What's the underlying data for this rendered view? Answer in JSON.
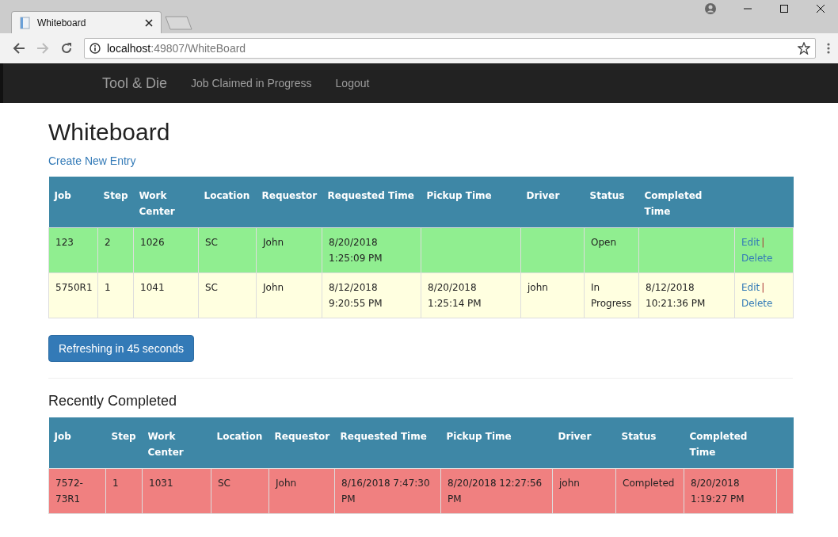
{
  "browser": {
    "tab_title": "Whiteboard",
    "address_host": "localhost",
    "address_rest": ":49807/WhiteBoard"
  },
  "navbar": {
    "brand": "Tool & Die",
    "links": [
      "Job Claimed in Progress",
      "Logout"
    ]
  },
  "page_title": "Whiteboard",
  "create_link": "Create New Entry",
  "jobs_table": {
    "columns": [
      "Job",
      "Step",
      "Work Center",
      "Location",
      "Requestor",
      "Requested Time",
      "Pickup Time",
      "Driver",
      "Status",
      "Completed Time",
      ""
    ],
    "rows": [
      {
        "color": "#90ee90",
        "cells": [
          "123",
          "2",
          "1026",
          "SC",
          "John",
          "8/20/2018 1:25:09 PM",
          "",
          "",
          "Open",
          ""
        ],
        "actions": {
          "edit": "Edit",
          "separator": "|",
          "delete": "Delete"
        }
      },
      {
        "color": "#ffffe0",
        "cells": [
          "5750R1",
          "1",
          "1041",
          "SC",
          "John",
          "8/12/2018 9:20:55 PM",
          "8/20/2018 1:25:14 PM",
          "john",
          "In Progress",
          "8/12/2018 10:21:36 PM"
        ],
        "actions": {
          "edit": "Edit",
          "separator": "|",
          "delete": "Delete"
        }
      }
    ]
  },
  "refresh_button": "Refreshing in 45 seconds",
  "recent_title": "Recently Completed",
  "recent_table": {
    "columns": [
      "Job",
      "Step",
      "Work Center",
      "Location",
      "Requestor",
      "Requested Time",
      "Pickup Time",
      "Driver",
      "Status",
      "Completed Time",
      ""
    ],
    "rows": [
      {
        "color": "#f08080",
        "cells": [
          "7572-73R1",
          "1",
          "1031",
          "SC",
          "John",
          "8/16/2018 7:47:30 PM",
          "8/20/2018 12:27:56 PM",
          "john",
          "Completed",
          "8/20/2018 1:19:27 PM",
          ""
        ]
      }
    ]
  }
}
